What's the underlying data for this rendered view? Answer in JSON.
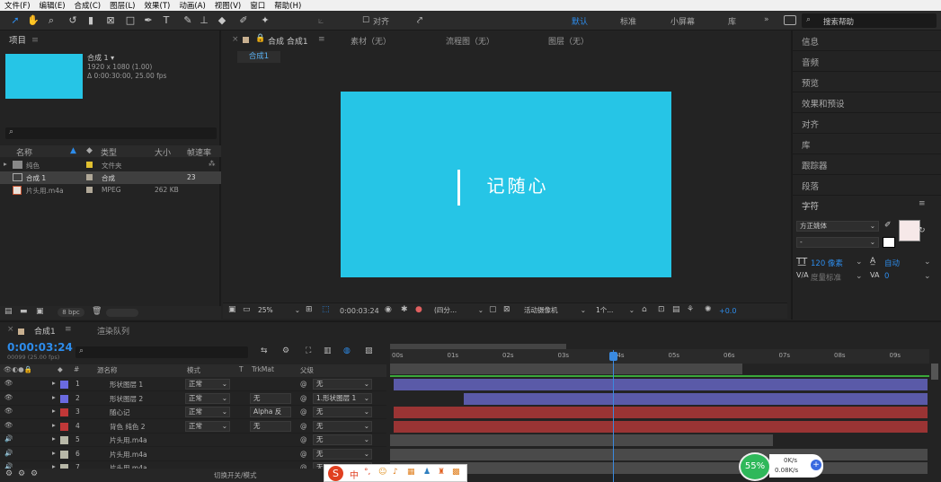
{
  "menu": [
    "文件(F)",
    "编辑(E)",
    "合成(C)",
    "图层(L)",
    "效果(T)",
    "动画(A)",
    "视图(V)",
    "窗口",
    "帮助(H)"
  ],
  "toolbar": {
    "align_label": "对齐",
    "workspaces": [
      "默认",
      "标准",
      "小屏幕",
      "库"
    ],
    "search_placeholder": "搜索帮助"
  },
  "project": {
    "title": "项目",
    "comp_name": "合成 1 ▾",
    "comp_res": "1920 x 1080 (1.00)",
    "comp_dur": "Δ 0:00:30:00, 25.00 fps",
    "columns": [
      "名称",
      "类型",
      "大小",
      "帧速率"
    ],
    "rows": [
      {
        "name": "纯色",
        "type": "文件夹",
        "size": "",
        "fps": "",
        "color": "#e0c030"
      },
      {
        "name": "合成 1",
        "type": "合成",
        "size": "",
        "fps": "23",
        "color": "#b0a898"
      },
      {
        "name": "片头用.m4a",
        "type": "MPEG",
        "size": "262 KB",
        "fps": "",
        "color": "#b0a898"
      }
    ],
    "bpc": "8 bpc"
  },
  "viewer": {
    "tabs": [
      "合成 合成1",
      "素材（无）",
      "流程图（无）",
      "图层（无）"
    ],
    "subtab": "合成1",
    "comp_text": "记随心",
    "zoom": "25%",
    "timecode": "0:00:03:24",
    "resolution": "(四分...",
    "camera": "活动摄像机",
    "views": "1个...",
    "exposure": "+0.0"
  },
  "right": {
    "items": [
      "信息",
      "音频",
      "预览",
      "效果和预设",
      "对齐",
      "库",
      "跟踪器",
      "段落"
    ],
    "char_title": "字符",
    "font": "方正姚体",
    "font_style": "-",
    "size": "120 像素",
    "leading": "自动",
    "kerning": "度量标准",
    "tracking": "0"
  },
  "timeline": {
    "tabs": [
      "合成1",
      "渲染队列"
    ],
    "timecode": "0:00:03:24",
    "frames": "00099 (25.00 fps)",
    "headers": {
      "name": "源名称",
      "mode": "模式",
      "t": "T",
      "trkmat": "TrkMat",
      "parent": "父级"
    },
    "ruler": [
      "00s",
      "01s",
      "02s",
      "03s",
      "04s",
      "05s",
      "06s",
      "07s",
      "08s",
      "09s"
    ],
    "layers": [
      {
        "num": "1",
        "name": "形状图层 1",
        "mode": "正常",
        "trk": "",
        "parent": "无",
        "color": "#6a6ae0",
        "bar": "#5a5aa8"
      },
      {
        "num": "2",
        "name": "形状图层 2",
        "mode": "正常",
        "trk": "无",
        "parent": "1.形状图层 1",
        "color": "#6a6ae0",
        "bar": "#5a5aa8"
      },
      {
        "num": "3",
        "name": "随心记",
        "mode": "正常",
        "trk": "Alpha 反",
        "parent": "无",
        "color": "#c03838",
        "bar": "#9a3434"
      },
      {
        "num": "4",
        "name": "背色 纯色 2",
        "mode": "正常",
        "trk": "无",
        "parent": "无",
        "color": "#c03838",
        "bar": "#9a3434"
      },
      {
        "num": "5",
        "name": "片头用.m4a",
        "mode": "",
        "trk": "",
        "parent": "无",
        "color": "#b8b8a8",
        "bar": "#4a4a4a"
      },
      {
        "num": "6",
        "name": "片头用.m4a",
        "mode": "",
        "trk": "",
        "parent": "无",
        "color": "#b8b8a8",
        "bar": "#4a4a4a"
      },
      {
        "num": "7",
        "name": "片头用.m4a",
        "mode": "",
        "trk": "",
        "parent": "无",
        "color": "#b8b8a8",
        "bar": "#4a4a4a"
      }
    ],
    "switch_label": "切换开关/模式"
  },
  "network": {
    "pct": "55%",
    "up": "0K/s",
    "down": "0.08K/s"
  }
}
